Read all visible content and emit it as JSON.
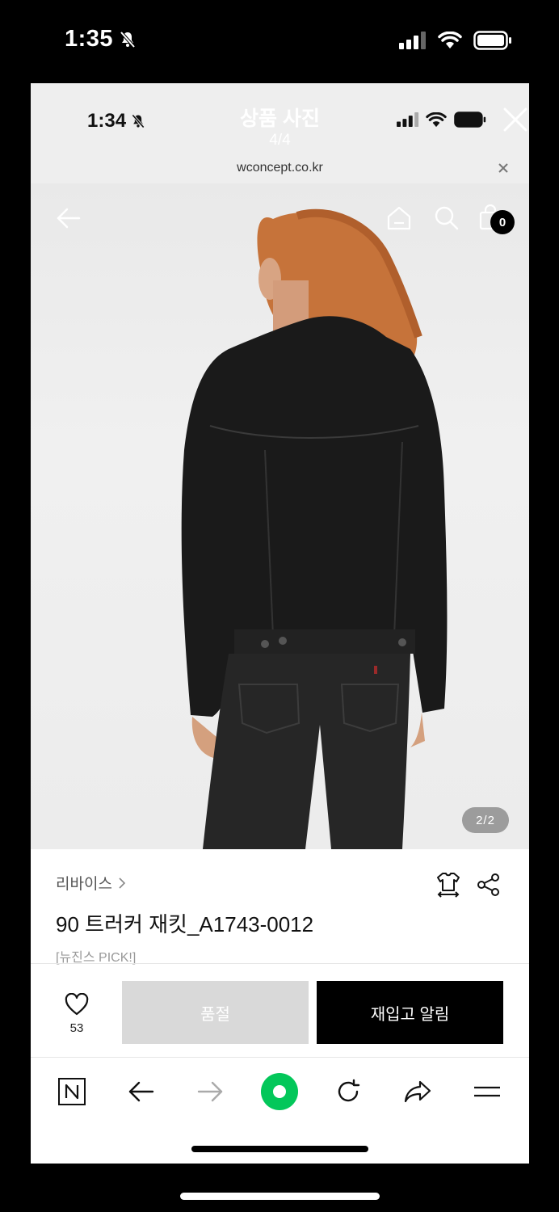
{
  "outer_status": {
    "time": "1:35"
  },
  "inner_status": {
    "time": "1:34"
  },
  "viewer": {
    "title": "상품 사진",
    "count": "4/4"
  },
  "browser": {
    "url": "wconcept.co.kr"
  },
  "product_nav": {
    "cart_count": "0"
  },
  "photo": {
    "counter": "2/2"
  },
  "product": {
    "brand": "리바이스",
    "title": "90 트러커 재킷_A1743-0012",
    "tag": "[뉴진스 PICK!]"
  },
  "actions": {
    "like_count": "53",
    "soldout_label": "품절",
    "notify_label": "재입고 알림"
  },
  "colors": {
    "accent_green": "#03c75a",
    "dark": "#000000"
  }
}
